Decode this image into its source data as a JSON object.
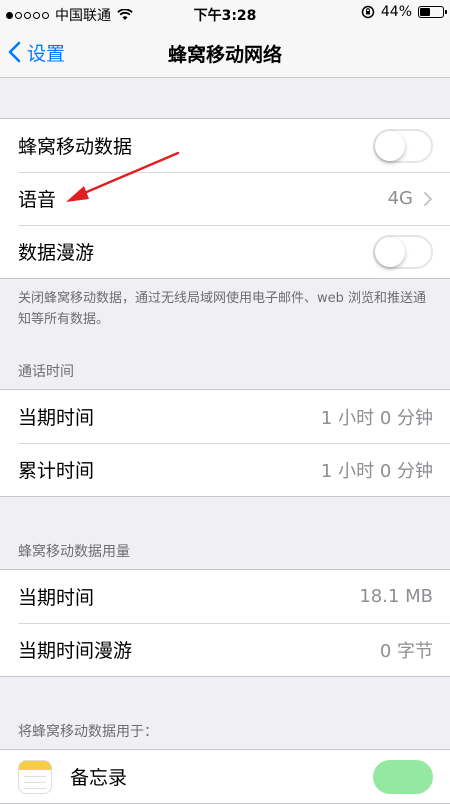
{
  "status_bar": {
    "carrier": "中国联通",
    "time": "下午3:28",
    "battery": "44%",
    "battery_level": 0.44
  },
  "nav": {
    "back_label": "设置",
    "title": "蜂窝移动网络"
  },
  "cellular_group": {
    "cellular_data_label": "蜂窝移动数据",
    "cellular_data_on": false,
    "voice_label": "语音",
    "voice_value": "4G",
    "roaming_label": "数据漫游",
    "roaming_on": false
  },
  "footer_note": "关闭蜂窝移动数据，通过无线局域网使用电子邮件、web 浏览和推送通知等所有数据。",
  "call_time": {
    "header": "通话时间",
    "rows": [
      {
        "label": "当期时间",
        "value": "1 小时 0 分钟"
      },
      {
        "label": "累计时间",
        "value": "1 小时 0 分钟"
      }
    ]
  },
  "data_usage": {
    "header": "蜂窝移动数据用量",
    "rows": [
      {
        "label": "当期时间",
        "value": "18.1 MB"
      },
      {
        "label": "当期时间漫游",
        "value": "0 字节"
      }
    ]
  },
  "apps": {
    "header": "将蜂窝移动数据用于：",
    "items": [
      {
        "label": "备忘录",
        "icon": "notes-icon",
        "on": true
      }
    ]
  },
  "colors": {
    "accent": "#007aff",
    "annotation_arrow": "#e02020",
    "toggle_on": "#4cd964"
  }
}
